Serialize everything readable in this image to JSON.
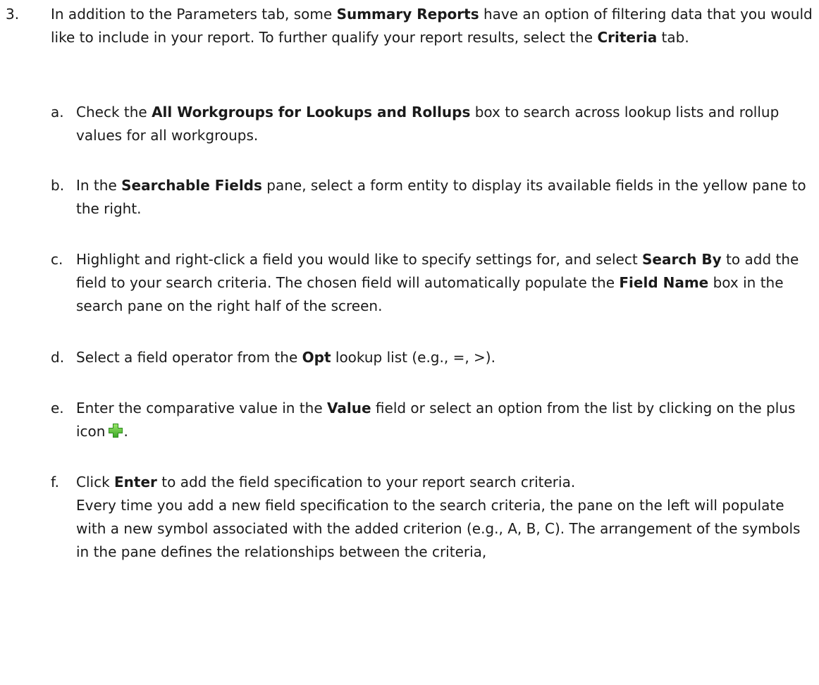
{
  "step": {
    "number": "3.",
    "p1": "In addition to the Parameters tab, some ",
    "b1": "Summary Reports",
    "p2": " have an option of filtering data that you would like to include in your report. To further qualify your report results, select the ",
    "b2": "Criteria",
    "p3": " tab."
  },
  "items": {
    "a": {
      "letter": "a.",
      "p1": "Check the ",
      "b1": "All Workgroups for Lookups and Rollups",
      "p2": " box to search across lookup lists and rollup values for all workgroups."
    },
    "b": {
      "letter": "b.",
      "p1": "In the ",
      "b1": "Searchable Fields",
      "p2": " pane, select a form entity to display its available fields in the yellow pane to the right."
    },
    "c": {
      "letter": "c.",
      "p1": "Highlight and right-click a field you would like to specify settings for, and select ",
      "b1": "Search By",
      "p2": " to add the field to your search criteria. The chosen field will automatically populate the ",
      "b2": "Field Name",
      "p3": " box in the search pane on the right half of the screen."
    },
    "d": {
      "letter": "d.",
      "p1": "Select a field operator from the ",
      "b1": "Opt",
      "p2": " lookup list (e.g., =, >)."
    },
    "e": {
      "letter": "e.",
      "p1": "Enter the comparative value in the ",
      "b1": "Value",
      "p2": " field or select an option from the list by clicking on the plus icon",
      "p3": ".",
      "icon": "plus-icon"
    },
    "f": {
      "letter": "f.",
      "p1": "Click ",
      "b1": "Enter",
      "p2": " to add the field specification to your report search criteria.",
      "p3": "Every time you add a new field specification to the search criteria, the pane on the left will populate with a new symbol associated with the added criterion (e.g., A, B, C). The arrangement of the symbols in the pane defines the relationships between the criteria,"
    }
  }
}
